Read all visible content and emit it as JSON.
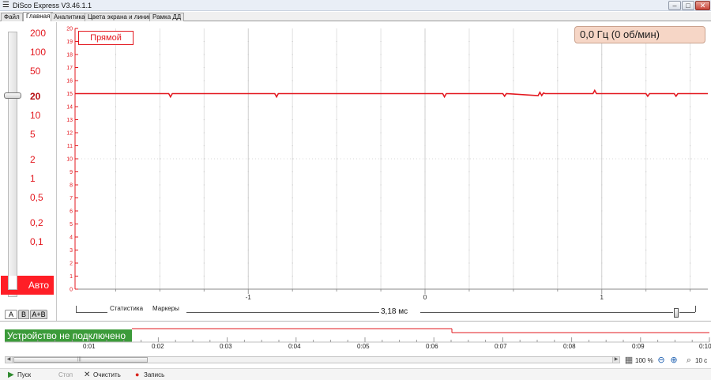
{
  "window": {
    "title": "DiSco Express V3.46.1.1",
    "min_glyph": "–",
    "max_glyph": "□",
    "close_glyph": "✕"
  },
  "menu": {
    "tabs": [
      "Файл",
      "Главная",
      "Аналитика",
      "Цвета экрана и линий",
      "Рамка ДД"
    ],
    "active": "Главная"
  },
  "scale": {
    "labels": [
      "200",
      "100",
      "50",
      "20",
      "10",
      "5",
      "2",
      "1",
      "0,5",
      "0,2",
      "0,1"
    ],
    "selected": "20",
    "auto_label": "Авто"
  },
  "channels": {
    "tabs": [
      "A",
      "B",
      "A+B"
    ],
    "active": "A"
  },
  "plot": {
    "mode_button": "Прямой",
    "frequency": "0,0 Гц (0 об/мин)",
    "trace_color": "#e3181f"
  },
  "chart_data": {
    "type": "line",
    "title": "",
    "xlabel": "",
    "ylabel": "",
    "ylim": [
      0,
      20
    ],
    "yticks": [
      0,
      1,
      2,
      3,
      4,
      5,
      6,
      7,
      8,
      9,
      10,
      11,
      12,
      13,
      14,
      15,
      16,
      17,
      18,
      19,
      20
    ],
    "xlim": [
      -1.98,
      1.6
    ],
    "xticks": [
      -1,
      0,
      1
    ],
    "grid": true,
    "series": [
      {
        "values_x": [
          -1.98,
          -1.45,
          -1.44,
          -1.43,
          -0.85,
          -0.84,
          -0.83,
          0.1,
          0.11,
          0.12,
          0.44,
          0.45,
          0.46,
          0.64,
          0.65,
          0.66,
          0.67,
          0.68,
          0.95,
          0.96,
          0.97,
          1.25,
          1.26,
          1.27,
          1.41,
          1.42,
          1.43,
          1.6
        ],
        "values_y": [
          15.0,
          15.0,
          14.75,
          15.0,
          15.0,
          14.75,
          15.0,
          15.0,
          14.75,
          15.0,
          15.0,
          14.8,
          15.0,
          14.85,
          15.1,
          14.85,
          15.05,
          15.0,
          15.0,
          15.25,
          15.0,
          15.0,
          14.8,
          15.0,
          15.0,
          14.8,
          15.0,
          15.0
        ]
      }
    ]
  },
  "stats": {
    "statistics_label": "Статистика",
    "markers_label": "Маркеры",
    "time_per_div": "3,18 мс"
  },
  "timeline": {
    "status": "Устройство не подключено",
    "ticks": [
      "0:01",
      "0:02",
      "0:03",
      "0:04",
      "0:05",
      "0:06",
      "0:07",
      "0:08",
      "0:09",
      "0:10"
    ],
    "zoom_percent": "100 %",
    "window_length": "10 с"
  },
  "toolbar": {
    "start": "Пуск",
    "stop": "Стоп",
    "clear": "Очистить",
    "record": "Запись"
  }
}
